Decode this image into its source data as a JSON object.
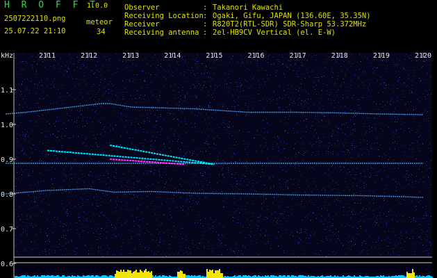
{
  "header": {
    "app_title": "H R O F F T",
    "app_version": "1.0.0",
    "file_name": "2507222110.png",
    "timestamp": "25.07.22 21:10",
    "meteor_label": "meteor",
    "meteor_count": "34"
  },
  "station_info": [
    {
      "label": "Observer",
      "value": "Takanori Kawachi"
    },
    {
      "label": "Receiving Location",
      "value": "Ogaki, Gifu, JAPAN (136.60E, 35.35N)"
    },
    {
      "label": "Receiver",
      "value": "R820T2(RTL-SDR) SDR-Sharp 53.372MHz"
    },
    {
      "label": "Receiving antenna",
      "value": "2el-HB9CV Vertical (el. E-W)"
    }
  ],
  "colors": {
    "background": "#000000",
    "header_text": "#e0e000",
    "title_green": "#34d34a",
    "plot_bg": "#05051c",
    "tick_text": "#e8e8e8",
    "trace": "#4aa8ff",
    "echo_cyan": "#00e5ff",
    "echo_magenta": "#ff3cff",
    "bar_yellow": "#f2e600",
    "bar_cyan": "#00c8ff"
  },
  "spectrogram": {
    "y_unit": "kHz",
    "y_ticks": [
      "1.1",
      "1.0",
      "0.9",
      "0.8",
      "0.7",
      "0.6"
    ],
    "x_ticks": [
      "2111",
      "2112",
      "2113",
      "2114",
      "2115",
      "2116",
      "2117",
      "2118",
      "2119",
      "2120"
    ],
    "traces_khz": [
      {
        "name": "upper",
        "points": [
          [
            2110.0,
            1.03
          ],
          [
            2110.5,
            1.035
          ],
          [
            2112.3,
            1.06
          ],
          [
            2112.5,
            1.06
          ],
          [
            2113.0,
            1.05
          ],
          [
            2114.5,
            1.045
          ],
          [
            2115.8,
            1.035
          ],
          [
            2117.0,
            1.035
          ],
          [
            2118.0,
            1.033
          ],
          [
            2119.0,
            1.03
          ],
          [
            2120.0,
            1.028
          ]
        ]
      },
      {
        "name": "carrier",
        "points": [
          [
            2110.0,
            0.888
          ],
          [
            2120.0,
            0.888
          ]
        ]
      },
      {
        "name": "lower",
        "points": [
          [
            2110.0,
            0.8
          ],
          [
            2111.0,
            0.81
          ],
          [
            2112.0,
            0.815
          ],
          [
            2112.6,
            0.805
          ],
          [
            2113.5,
            0.807
          ],
          [
            2114.5,
            0.802
          ],
          [
            2115.8,
            0.8
          ],
          [
            2117.0,
            0.797
          ],
          [
            2118.5,
            0.795
          ],
          [
            2119.5,
            0.792
          ],
          [
            2120.0,
            0.79
          ]
        ]
      }
    ],
    "meteor_echoes": [
      {
        "start": [
          2111.0,
          0.925
        ],
        "end": [
          2115.0,
          0.885
        ],
        "color": "echo_cyan"
      },
      {
        "start": [
          2112.5,
          0.94
        ],
        "end": [
          2115.0,
          0.885
        ],
        "color": "echo_cyan"
      },
      {
        "start": [
          2112.5,
          0.9
        ],
        "end": [
          2114.3,
          0.885
        ],
        "color": "echo_magenta"
      }
    ],
    "signal_bars": {
      "bright_segments": [
        [
          2112.6,
          2113.5
        ],
        [
          2114.1,
          2114.3
        ],
        [
          2114.8,
          2115.2
        ],
        [
          2119.6,
          2119.8
        ]
      ]
    }
  }
}
